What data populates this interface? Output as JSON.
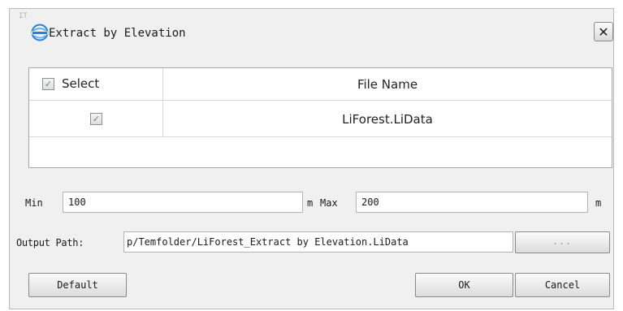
{
  "window": {
    "title": "Extract by Elevation",
    "corner_mark": "IT",
    "logo_icon": "lidar360-logo-icon",
    "close_label": "✕"
  },
  "table": {
    "header_select_label": "Select",
    "header_file_label": "File Name",
    "header_checked": true,
    "rows": [
      {
        "checked": true,
        "file_name": "LiForest.LiData"
      }
    ]
  },
  "elevation": {
    "min_label": "Min",
    "min_value": "100",
    "min_unit": "m",
    "max_label": "Max",
    "max_value": "200",
    "max_unit": "m"
  },
  "output": {
    "label": "Output Path:",
    "value": "p/Temfolder/LiForest_Extract by Elevation.LiData",
    "browse_label": "..."
  },
  "buttons": {
    "default_label": "Default",
    "ok_label": "OK",
    "cancel_label": "Cancel"
  },
  "colors": {
    "dialog_bg": "#f0f0f0",
    "table_bg": "#ffffff",
    "logo_blue": "#2a7fd4"
  }
}
